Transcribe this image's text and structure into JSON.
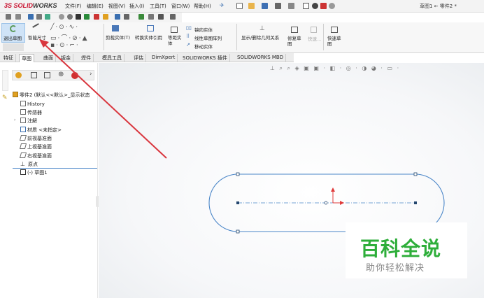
{
  "app": {
    "logo_prefix": "3S",
    "logo_solid": "SOLID",
    "logo_works": "WORKS",
    "document_title": "草图1 ← 零件2 *"
  },
  "menu": [
    "文件(F)",
    "编辑(E)",
    "视图(V)",
    "插入(I)",
    "工具(T)",
    "窗口(W)",
    "帮助(H)"
  ],
  "command_manager": {
    "exit_sketch": "退出草图",
    "smart_dimension": "智能尺寸",
    "trim": "剪裁实体(T)",
    "convert": "转换实体引用",
    "offset": "等距实体",
    "mirror": "镜向实体",
    "linear_pattern": "线性草图阵列",
    "move": "移动实体",
    "relations": "显示/删除几何关系",
    "repair": "修复草图",
    "quick_snap": "快速...",
    "rapid_sketch": "快速草图"
  },
  "tabs": [
    "特征",
    "草图",
    "曲面",
    "钣金",
    "焊件",
    "模具工具",
    "评估",
    "DimXpert",
    "SOLIDWORKS 插件",
    "SOLIDWORKS MBD"
  ],
  "active_tab": "草图",
  "feature_tree": {
    "root": "零件2 (默认<<默认>_显示状态",
    "items": [
      "History",
      "传感器",
      "注解",
      "材质 <未指定>",
      "前视基准面",
      "上视基准面",
      "右视基准面",
      "原点",
      "(-) 草图1"
    ]
  },
  "watermark": {
    "title": "百科全说",
    "subtitle": "助你轻松解决"
  },
  "colors": {
    "accent": "#c8102e",
    "sketch_line": "#4a86c8",
    "arrow": "#e03a3a",
    "watermark_green": "#2eae3a"
  }
}
